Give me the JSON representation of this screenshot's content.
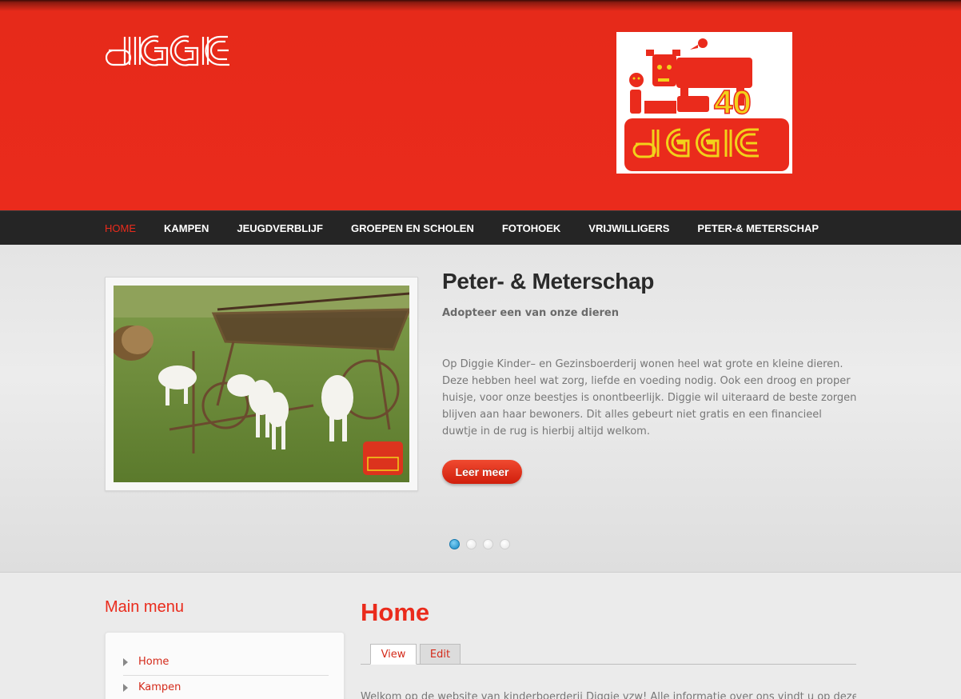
{
  "header": {
    "logo_text": "DIGGIE",
    "badge_number": "40"
  },
  "nav": {
    "items": [
      {
        "label": "HOME",
        "active": true
      },
      {
        "label": "KAMPEN"
      },
      {
        "label": "JEUGDVERBLIJF"
      },
      {
        "label": "GROEPEN EN SCHOLEN"
      },
      {
        "label": "FOTOHOEK"
      },
      {
        "label": "VRIJWILLIGERS"
      },
      {
        "label": "PETER-& METERSCHAP"
      }
    ]
  },
  "slider": {
    "title": "Peter- & Meterschap",
    "subtitle": "Adopteer een van onze dieren",
    "text": "Op Diggie Kinder– en Gezinsboerderij wonen heel wat grote en kleine dieren. Deze hebben heel wat zorg, liefde en voeding nodig. Ook een droog en proper huisje, voor onze beestjes is onontbeerlijk. Diggie wil uiteraard de beste zorgen blijven aan haar bewoners. Dit alles gebeurt niet gratis en een financieel duwtje in de rug is hierbij altijd welkom.",
    "button_label": "Leer meer",
    "slide_count": 4,
    "active_slide": 1
  },
  "sidebar": {
    "title": "Main menu",
    "items": [
      {
        "label": "Home"
      },
      {
        "label": "Kampen"
      }
    ]
  },
  "main": {
    "title": "Home",
    "tabs": [
      {
        "label": "View",
        "active": true
      },
      {
        "label": "Edit"
      }
    ],
    "body_partial": "Welkom op de website van kinderboerderij Diggie vzw! Alle informatie over ons vindt u op deze"
  },
  "colors": {
    "brand_red": "#ea2b1c",
    "nav_bg": "#252525",
    "badge_yellow": "#f2d21a"
  }
}
